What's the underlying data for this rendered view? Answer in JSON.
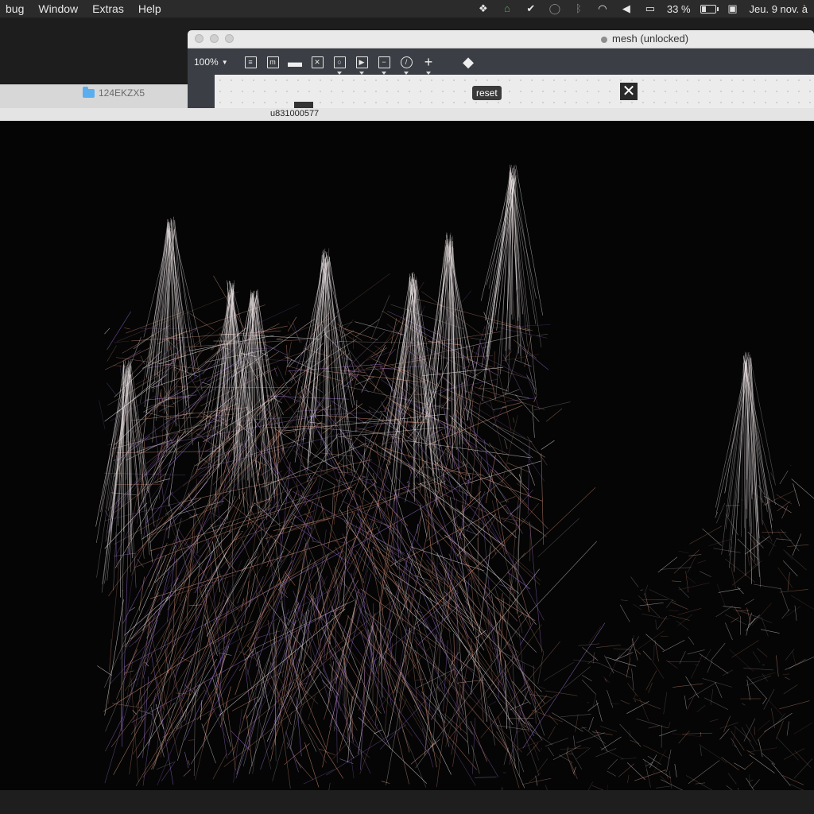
{
  "menubar": {
    "menus": [
      "bug",
      "Window",
      "Extras",
      "Help"
    ],
    "battery": "33 %",
    "battery_level": 0.33,
    "clock": "Jeu. 9 nov. à",
    "icons": [
      "dropbox-icon",
      "home-icon",
      "checkmark-icon",
      "chat-icon",
      "bluetooth-icon",
      "wifi-icon",
      "volume-icon",
      "airplay-icon",
      "battery-icon",
      "calendar-icon"
    ]
  },
  "finder": {
    "folder_name": "124EKZX5"
  },
  "patcher": {
    "title": "mesh (unlocked)",
    "zoom": "100%",
    "tools": [
      "presentation",
      "message",
      "comment",
      "toggle",
      "button",
      "play",
      "slider",
      "dial",
      "add",
      "paint"
    ],
    "reset_label": "reset",
    "close_glyph": "✕"
  },
  "object_label": "u831000577",
  "render": {
    "colors": {
      "warm": "#d9937a",
      "white": "#f2e9ea",
      "violet": "#9b6fcf"
    }
  }
}
